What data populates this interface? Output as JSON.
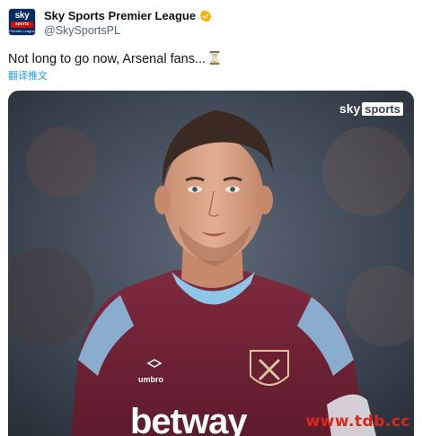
{
  "account": {
    "display_name": "Sky Sports Premier League",
    "handle": "@SkySportsPL",
    "avatar": {
      "line1": "sky",
      "line2": "sports",
      "line3": "Premier League"
    },
    "verified_icon": "verified-badge-icon",
    "verified_color": "#f4b400"
  },
  "tweet": {
    "text": "Not long to go now, Arsenal fans...",
    "emoji_icon": "hourglass-icon",
    "translate_label": "翻译推文"
  },
  "media": {
    "logo_sky": "sky",
    "logo_sports": "sports",
    "kit_brand": "umbro",
    "sponsor": "betway",
    "site_watermark": "www.tdb.cc"
  },
  "colors": {
    "link": "#1d9bf0",
    "text": "#0f1419",
    "secondary": "#536471",
    "claret": "#7a2639",
    "sky_blue": "#8ec5e8"
  }
}
